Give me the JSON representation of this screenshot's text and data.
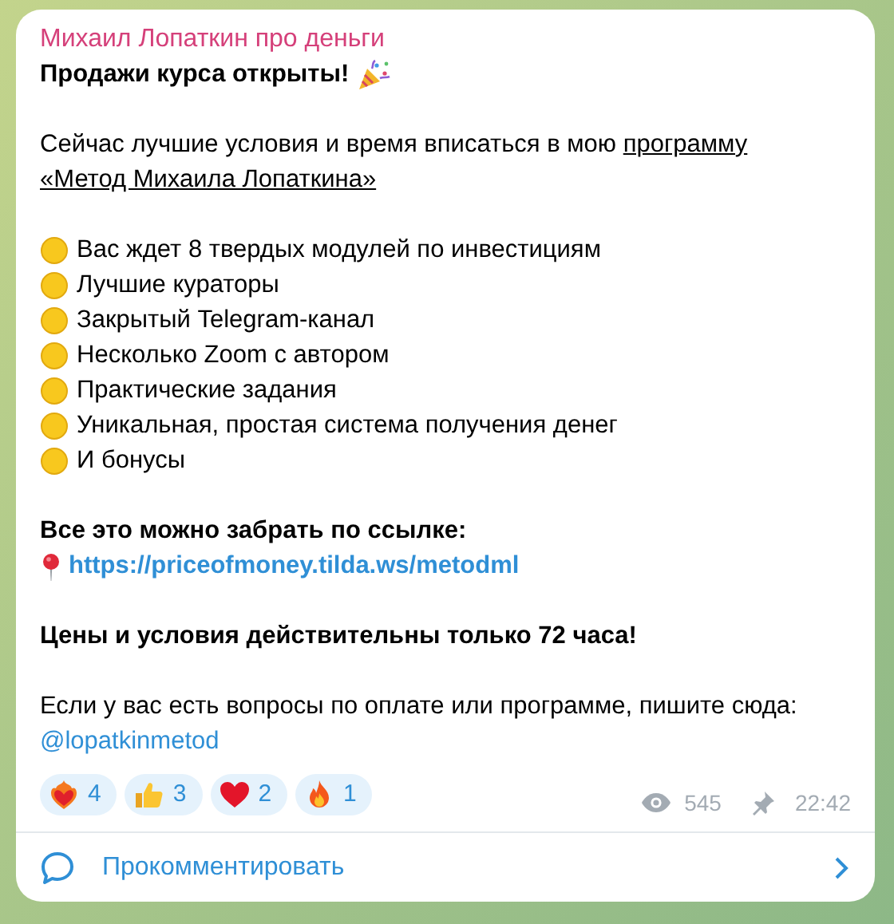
{
  "channel_name": "Михаил Лопаткин про деньги",
  "title": "Продажи курса открыты!",
  "intro": {
    "text": "Сейчас лучшие условия и время вписаться в мою",
    "link_parts": [
      "программу",
      "«Метод Михаила Лопаткина»"
    ]
  },
  "bullets": [
    "Вас ждет 8 твердых модулей по инвестициям",
    "Лучшие кураторы",
    "Закрытый Telegram-канал",
    "Несколько Zoom с автором",
    "Практические задания",
    "Уникальная, простая система получения денег",
    "И бонусы"
  ],
  "link_label": "Все это можно забрать по ссылке:",
  "link": "https://priceofmoney.tilda.ws/metodml",
  "notice": "Цены и условия действительны только 72 часа!",
  "contact": {
    "text": "Если у вас есть вопросы по оплате или программе, пишите сюда:",
    "handle": "@lopatkinmetod"
  },
  "reactions": [
    {
      "kind": "heart-fire",
      "count": "4"
    },
    {
      "kind": "thumbs-up",
      "count": "3"
    },
    {
      "kind": "heart",
      "count": "2"
    },
    {
      "kind": "fire",
      "count": "1"
    }
  ],
  "views": "545",
  "time": "22:42",
  "comment_button": "Прокомментировать"
}
